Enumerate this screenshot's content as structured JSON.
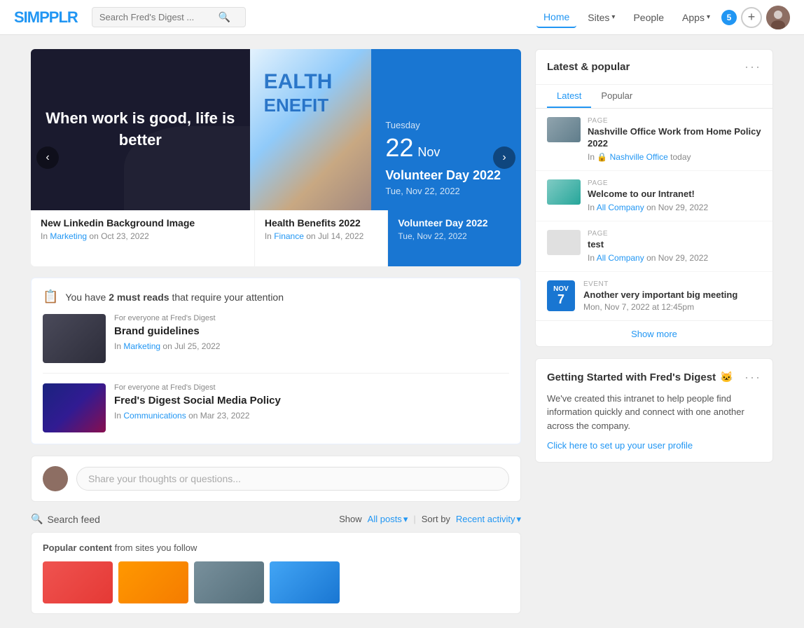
{
  "brand": {
    "logo_text_1": "SIM",
    "logo_text_2": "PPLR"
  },
  "navbar": {
    "search_placeholder": "Search Fred's Digest ...",
    "home_label": "Home",
    "sites_label": "Sites",
    "people_label": "People",
    "apps_label": "Apps",
    "badge_count": "5"
  },
  "carousel": {
    "slide1": {
      "text": "When work is good, life is better",
      "title": "New Linkedin Background Image",
      "meta_prefix": "In",
      "category": "Marketing",
      "date": "Oct 23, 2022"
    },
    "slide2": {
      "health_line1": "EALTH",
      "health_line2": "ENEFIT",
      "title": "Health Benefits 2022",
      "meta_prefix": "In",
      "category": "Finance",
      "date": "Jul 14, 2022"
    },
    "slide3": {
      "day_label": "Tuesday",
      "day_num": "22",
      "month": "Nov",
      "event_title": "Volunteer Day 2022",
      "event_date": "Tue, Nov 22, 2022"
    },
    "btn_left": "‹",
    "btn_right": "›"
  },
  "must_reads": {
    "header_prefix": "You have",
    "count": "2 must reads",
    "header_suffix": "that require your attention",
    "items": [
      {
        "for_text": "For everyone at Fred's Digest",
        "title": "Brand guidelines",
        "meta_prefix": "In",
        "category": "Marketing",
        "date": "Jul 25, 2022"
      },
      {
        "for_text": "For everyone at Fred's Digest",
        "title": "Fred's Digest Social Media Policy",
        "meta_prefix": "In",
        "category": "Communications",
        "date": "Mar 23, 2022"
      }
    ]
  },
  "share_box": {
    "placeholder": "Share your thoughts or questions..."
  },
  "search_feed": {
    "title": "Search feed",
    "show_label": "Show",
    "all_posts": "All posts",
    "sort_label": "Sort by",
    "recent_activity": "Recent activity",
    "popular_label": "Popular content",
    "popular_suffix": "from sites you follow"
  },
  "latest_popular": {
    "panel_title": "Latest & popular",
    "dots": "···",
    "tabs": [
      "Latest",
      "Popular"
    ],
    "active_tab": "Latest",
    "items": [
      {
        "tag": "PAGE",
        "title": "Nashville Office Work from Home Policy 2022",
        "meta_in": "In",
        "location": "Nashville Office",
        "time": "today"
      },
      {
        "tag": "PAGE",
        "title": "Welcome to our Intranet!",
        "meta_in": "In",
        "location": "All Company",
        "time": "on Nov 29, 2022"
      },
      {
        "tag": "PAGE",
        "title": "test",
        "meta_in": "In",
        "location": "All Company",
        "time": "on Nov 29, 2022"
      }
    ],
    "event": {
      "tag": "EVENT",
      "month": "NOV",
      "day": "7",
      "title": "Another very important big meeting",
      "datetime": "Mon, Nov 7, 2022 at 12:45pm"
    },
    "show_more": "Show more"
  },
  "getting_started": {
    "title": "Getting Started with Fred's Digest",
    "emoji": "🐱",
    "dots": "···",
    "text": "We've created this intranet to help people find information quickly and connect with one another across the company.",
    "cta": "Click here to set up your user profile"
  }
}
